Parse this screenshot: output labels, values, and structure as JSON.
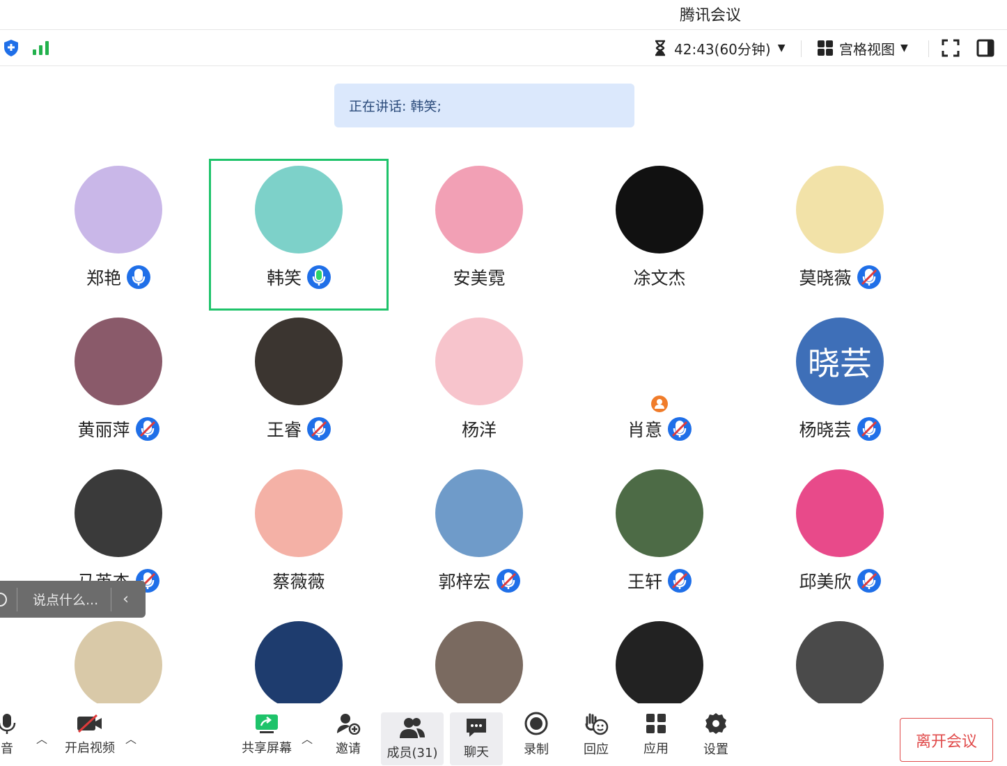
{
  "window": {
    "title": "腾讯会议"
  },
  "toolbar": {
    "timer": "42:43(60分钟)",
    "view_mode": "宫格视图"
  },
  "speaking": {
    "text": "正在讲话: 韩笑;"
  },
  "participants": [
    {
      "name": "郑艳",
      "mic": "on",
      "color": "#c9b7e8"
    },
    {
      "name": "韩笑",
      "mic": "speaking",
      "color": "#7dd1c9",
      "active": true
    },
    {
      "name": "安美霓",
      "mic": "none",
      "color": "#f2a0b5"
    },
    {
      "name": "凃文杰",
      "mic": "none",
      "color": "#111111"
    },
    {
      "name": "莫晓薇",
      "mic": "muted",
      "color": "#f2e2a8"
    },
    {
      "name": "黄丽萍",
      "mic": "muted",
      "color": "#8a5a6a"
    },
    {
      "name": "王睿",
      "mic": "muted",
      "color": "#3b3530"
    },
    {
      "name": "杨洋",
      "mic": "none",
      "color": "#f7c4cc"
    },
    {
      "name": "肖意",
      "mic": "muted",
      "color": "#ffffff"
    },
    {
      "name": "杨晓芸",
      "mic": "muted",
      "color": "#3e6fb8",
      "initials": "晓芸"
    },
    {
      "name": "马英杰",
      "mic": "muted",
      "color": "#3a3a3a"
    },
    {
      "name": "蔡薇薇",
      "mic": "none",
      "color": "#f4b1a6"
    },
    {
      "name": "郭梓宏",
      "mic": "muted",
      "color": "#6f9bc9"
    },
    {
      "name": "王轩",
      "mic": "muted",
      "color": "#4d6b46"
    },
    {
      "name": "邱美欣",
      "mic": "muted",
      "color": "#e84a8a"
    },
    {
      "name": "",
      "mic": "none",
      "color": "#d9c9a8"
    },
    {
      "name": "",
      "mic": "none",
      "color": "#1e3c6e"
    },
    {
      "name": "",
      "mic": "none",
      "color": "#7a6a60"
    },
    {
      "name": "",
      "mic": "none",
      "color": "#222222"
    },
    {
      "name": "",
      "mic": "none",
      "color": "#4a4a4a"
    }
  ],
  "chat_input": {
    "placeholder": "说点什么..."
  },
  "bottom": {
    "audio": "音",
    "video": "开启视频",
    "share": "共享屏幕",
    "invite": "邀请",
    "members": "成员(31)",
    "chat": "聊天",
    "record": "录制",
    "react": "回应",
    "apps": "应用",
    "settings": "设置",
    "leave": "离开会议"
  }
}
